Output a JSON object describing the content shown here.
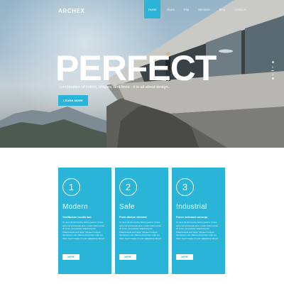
{
  "header": {
    "logo": "ARCHEX",
    "nav": [
      {
        "label": "Home",
        "active": true
      },
      {
        "label": "About",
        "active": false
      },
      {
        "label": "Faq",
        "active": false
      },
      {
        "label": "Services",
        "active": false
      },
      {
        "label": "Blog",
        "active": false
      },
      {
        "label": "Contacts",
        "active": false
      }
    ]
  },
  "hero": {
    "headline": "PERFECT",
    "tagline": "combination of colors, shapes, and lines - it is all about design.",
    "button_label": "LEARN MORE",
    "slider": {
      "current": "1",
      "total": "3"
    }
  },
  "cards": [
    {
      "number": "1",
      "title": "Modern",
      "subtitle": "Vestibulum iaculis laci",
      "body": "Ut nunc sit amet justo dictum auctor. Fusce euismod consequat ante. Lorem ipsum dolor sit amet, consectetur adipiscing elit. Pellentesque sed dolor. Aliquam congue fermentum nisl. Mauris accumsan nulla vel diam. Sed in lacus ut enim adipiscing aliquet.",
      "button_label": "MORE"
    },
    {
      "number": "2",
      "title": "Safe",
      "subtitle": "Proin dictum element",
      "body": "Ut nunc sit amet justo dictum auctor. Fusce euismod consequat ante. Lorem ipsum dolor sit amet, consectetur adipiscing elit. Pellentesque sed dolor. Aliquam congue fermentum nisl. Mauris accumsan nulla vel diam. Sed in lacus ut enim adipiscing aliquet.",
      "button_label": "MORE"
    },
    {
      "number": "3",
      "title": "Industrial",
      "subtitle": "Fusce euismod consequ",
      "body": "Ut nunc sit amet justo dictum auctor. Fusce euismod consequat ante. Lorem ipsum dolor sit amet, consectetur adipiscing elit. Pellentesque sed dolor. Aliquam congue fermentum nisl. Mauris accumsan nulla vel diam. Sed in lacus ut enim adipiscing aliquet.",
      "button_label": "MORE"
    }
  ],
  "colors": {
    "accent": "#2ab4d8",
    "text_on_accent": "#ffffff",
    "page_background": "#ffffff"
  }
}
